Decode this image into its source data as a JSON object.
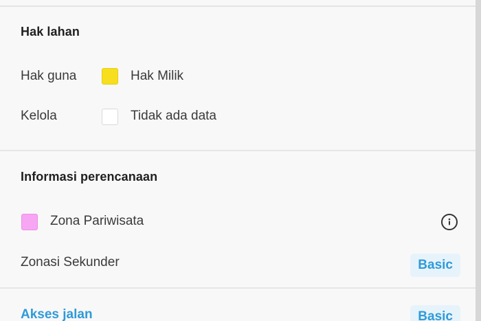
{
  "land_rights": {
    "title": "Hak lahan",
    "rows": [
      {
        "label": "Hak guna",
        "value": "Hak Milik",
        "swatch_color": "#f7df20"
      },
      {
        "label": "Kelola",
        "value": "Tidak ada data",
        "swatch_color": "#ffffff"
      }
    ]
  },
  "planning": {
    "title": "Informasi perencanaan",
    "zone": {
      "label": "Zona Pariwisata",
      "swatch_color": "#f7a6f3",
      "icon": "info-icon"
    },
    "secondary": {
      "label": "Zonasi Sekunder",
      "badge": "Basic"
    }
  },
  "road_access": {
    "title": "Akses jalan",
    "badge": "Basic"
  },
  "colors": {
    "accent": "#2f9ad8",
    "badge_background": "#e7f3fb",
    "divider": "#e6e6e6"
  }
}
